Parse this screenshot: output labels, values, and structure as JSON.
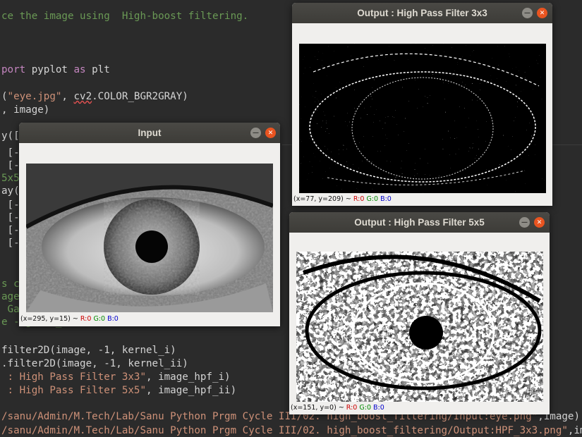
{
  "editor": {
    "lines": [
      {
        "parts": [
          {
            "t": "ce the image using  High-boost filtering.",
            "c": "c-comment"
          }
        ]
      },
      {
        "parts": [
          {
            "t": "port ",
            "c": "c-kw"
          },
          {
            "t": "pyplot ",
            "c": "c-plain"
          },
          {
            "t": "as ",
            "c": "c-kw"
          },
          {
            "t": "plt",
            "c": "c-plain"
          }
        ]
      },
      {
        "parts": [
          {
            "t": "(",
            "c": "c-plain"
          },
          {
            "t": "\"eye.jpg\"",
            "c": "c-str"
          },
          {
            "t": ", ",
            "c": "c-plain"
          },
          {
            "t": "cv2",
            "c": "c-plain"
          },
          {
            "t": ".COLOR_BGR2GRAY)",
            "c": "c-plain"
          }
        ]
      },
      {
        "parts": [
          {
            "t": ", image)",
            "c": "c-plain"
          }
        ]
      },
      {
        "parts": [
          {
            "t": "y([",
            "c": "c-plain"
          }
        ]
      },
      {
        "parts": [
          {
            "t": " [-",
            "c": "c-plain"
          }
        ]
      },
      {
        "parts": [
          {
            "t": " [-",
            "c": "c-plain"
          }
        ]
      },
      {
        "parts": [
          {
            "t": "5x5",
            "c": "c-comment"
          }
        ]
      },
      {
        "parts": [
          {
            "t": "ay(",
            "c": "c-plain"
          }
        ]
      },
      {
        "parts": [
          {
            "t": " [-",
            "c": "c-plain"
          }
        ]
      },
      {
        "parts": [
          {
            "t": " [-",
            "c": "c-plain"
          }
        ]
      },
      {
        "parts": [
          {
            "t": " [-",
            "c": "c-plain"
          }
        ]
      },
      {
        "parts": [
          {
            "t": " [-",
            "c": "c-plain"
          }
        ]
      },
      {
        "parts": [
          {
            "t": "s c",
            "c": "c-comment"
          },
          {
            "t": "                                                    s",
            "c": "c-comment"
          }
        ]
      },
      {
        "parts": [
          {
            "t": "age",
            "c": "c-comment"
          }
        ]
      },
      {
        "parts": [
          {
            "t": " Ga",
            "c": "c-comment"
          }
        ]
      },
      {
        "parts": [
          {
            "t": "e - gauss_mask",
            "c": "c-comment"
          }
        ]
      },
      {
        "parts": [
          {
            "t": "filter2D(image, -1, kernel_i)",
            "c": "c-plain"
          }
        ]
      },
      {
        "parts": [
          {
            "t": ".filter2D(image, -1, kernel_ii)",
            "c": "c-plain"
          }
        ]
      },
      {
        "parts": [
          {
            "t": " : High Pass Filter 3x3\"",
            "c": "c-str"
          },
          {
            "t": ", image_hpf_i)",
            "c": "c-plain"
          }
        ]
      },
      {
        "parts": [
          {
            "t": " : High Pass Filter 5x5\"",
            "c": "c-str"
          },
          {
            "t": ", image_hpf_ii)",
            "c": "c-plain"
          }
        ]
      },
      {
        "parts": [
          {
            "t": "/sanu/Admin/M.Tech/Lab/Sanu Python Prgm Cycle III/02. high_boost_filtering/Input:eye.png\"",
            "c": "c-str"
          },
          {
            "t": ",image)",
            "c": "c-plain"
          }
        ]
      },
      {
        "parts": [
          {
            "t": "/sanu/Admin/M.Tech/Lab/Sanu Python Prgm Cycle III/02. high_boost_filtering/Output:HPF_3x3.png\"",
            "c": "c-str"
          },
          {
            "t": ",ima",
            "c": "c-plain"
          }
        ]
      }
    ]
  },
  "windows": {
    "input": {
      "title": "Input",
      "status": {
        "coord": "(x=295, y=15) ~ ",
        "r": "R:0",
        "g": "G:0",
        "b": "B:0"
      }
    },
    "hpf3": {
      "title": "Output : High Pass Filter 3x3",
      "status": {
        "coord": "(x=77, y=209) ~ ",
        "r": "R:0",
        "g": "G:0",
        "b": "B:0"
      }
    },
    "hpf5": {
      "title": "Output : High Pass Filter 5x5",
      "status": {
        "coord": "(x=151, y=0) ~ ",
        "r": "R:0",
        "g": "G:0",
        "b": "B:0"
      }
    }
  },
  "buttons": {
    "minimize_glyph": "—",
    "close_glyph": "✕"
  },
  "colors": {
    "close_button": "#e95420",
    "titlebar": "#3d3c38",
    "editor_bg": "#2b2b2b"
  }
}
